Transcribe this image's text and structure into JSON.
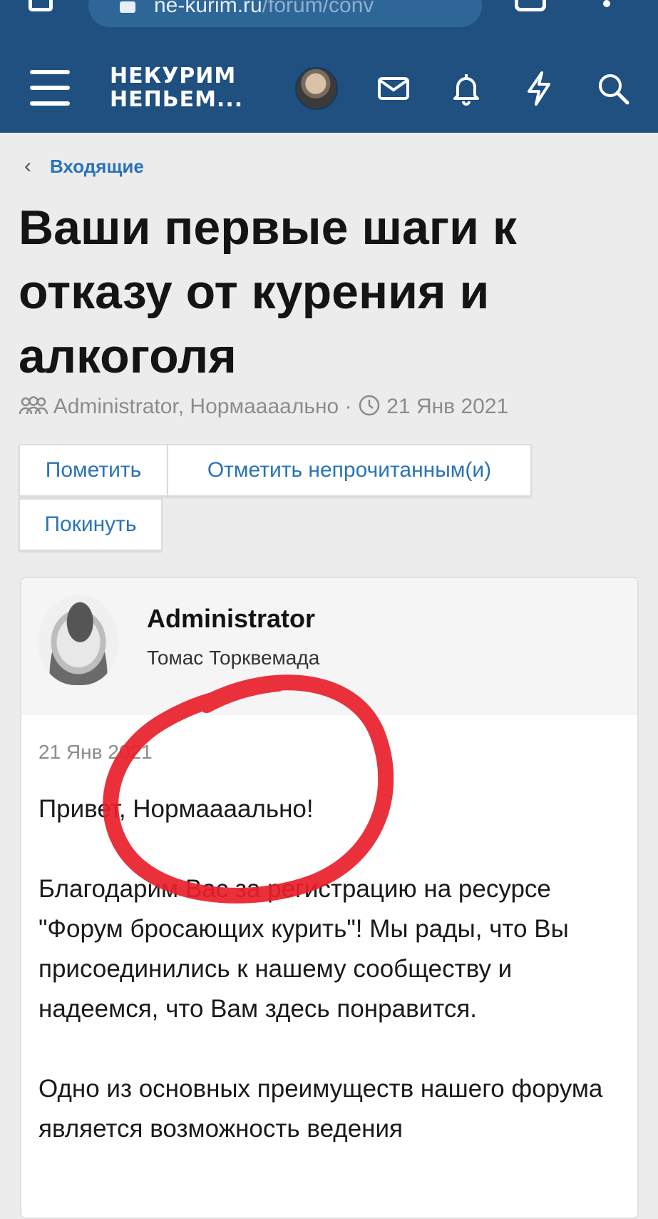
{
  "browser": {
    "url_host": "ne-kurim.ru",
    "url_path": "/forum/conv"
  },
  "header": {
    "logo_line1": "НЕКУРИМ",
    "logo_line2": "НЕПЬЕМ...",
    "accent": "#1f5080",
    "icons": [
      "menu-icon",
      "mail-icon",
      "bell-icon",
      "bolt-icon",
      "search-icon"
    ]
  },
  "breadcrumb": {
    "label": "Входящие"
  },
  "conversation": {
    "title": "Ваши первые шаги к отказу от курения и алкоголя",
    "participants": "Administrator, Нормаааально",
    "date": "21 Янв 2021"
  },
  "actions": {
    "mark": "Пометить",
    "mark_unread": "Отметить непрочитанным(и)",
    "leave": "Покинуть"
  },
  "message": {
    "author": "Administrator",
    "author_title": "Томас Торквемада",
    "date": "21 Янв 2021",
    "paragraphs": [
      "Привет, Нормаааально!",
      "Благодарим Вас за регистрацию на ресурсе \"Форум бросающих курить\"! Мы рады, что Вы присоединились к нашему сообществу и надеемся, что Вам здесь понравится.",
      "Одно из основных преимуществ нашего форума является возможность ведения"
    ]
  },
  "annotation_color": "#e8202a"
}
